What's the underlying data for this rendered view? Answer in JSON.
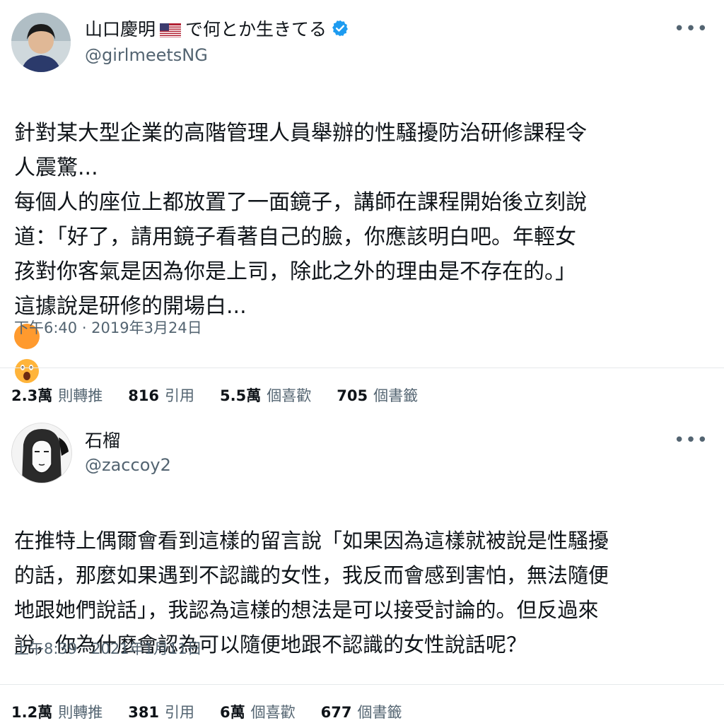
{
  "tweets": [
    {
      "display_name": "山口慶明",
      "name_suffix": "で何とか生きてる",
      "handle": "@girlmeetsNG",
      "verified": true,
      "more_icon": "more-dots-icon",
      "body": "針對某大型企業的高階管理人員舉辦的性騷擾防治研修課程令\n人震驚...\n每個人的座位上都放置了一面鏡子，講師在課程開始後立刻說\n道：「好了，請用鏡子看著自己的臉，你應該明白吧。年輕女\n孩對你客氣是因為你是上司，除此之外的理由是不存在的。」\n這據說是研修的開場白...",
      "emoji": "astonished-face-emoji",
      "timestamp": "下午6:40 · 2019年3月24日",
      "stats": [
        {
          "num": "2.3萬",
          "label": "則轉推"
        },
        {
          "num": "816",
          "label": "引用"
        },
        {
          "num": "5.5萬",
          "label": "個喜歡"
        },
        {
          "num": "705",
          "label": "個書籤"
        }
      ]
    },
    {
      "display_name": "石榴",
      "handle": "@zaccoy2",
      "verified": false,
      "more_icon": "more-dots-icon",
      "body": "在推特上偶爾會看到這樣的留言說「如果因為這樣就被說是性騷擾\n的話，那麼如果遇到不認識的女性，我反而會感到害怕，無法隨便\n地跟她們說話」，我認為這樣的想法是可以接受討論的。但反過來\n說，你為什麼會認為可以隨便地跟不認識的女性說話呢？",
      "timestamp": "上午8:39 · 2021年1月11日",
      "stats": [
        {
          "num": "1.2萬",
          "label": "則轉推"
        },
        {
          "num": "381",
          "label": "引用"
        },
        {
          "num": "6萬",
          "label": "個喜歡"
        },
        {
          "num": "677",
          "label": "個書籤"
        }
      ]
    }
  ],
  "colors": {
    "text": "#0f1419",
    "secondary": "#536471",
    "verified": "#1d9bf0",
    "divider": "#e6e9eb"
  }
}
